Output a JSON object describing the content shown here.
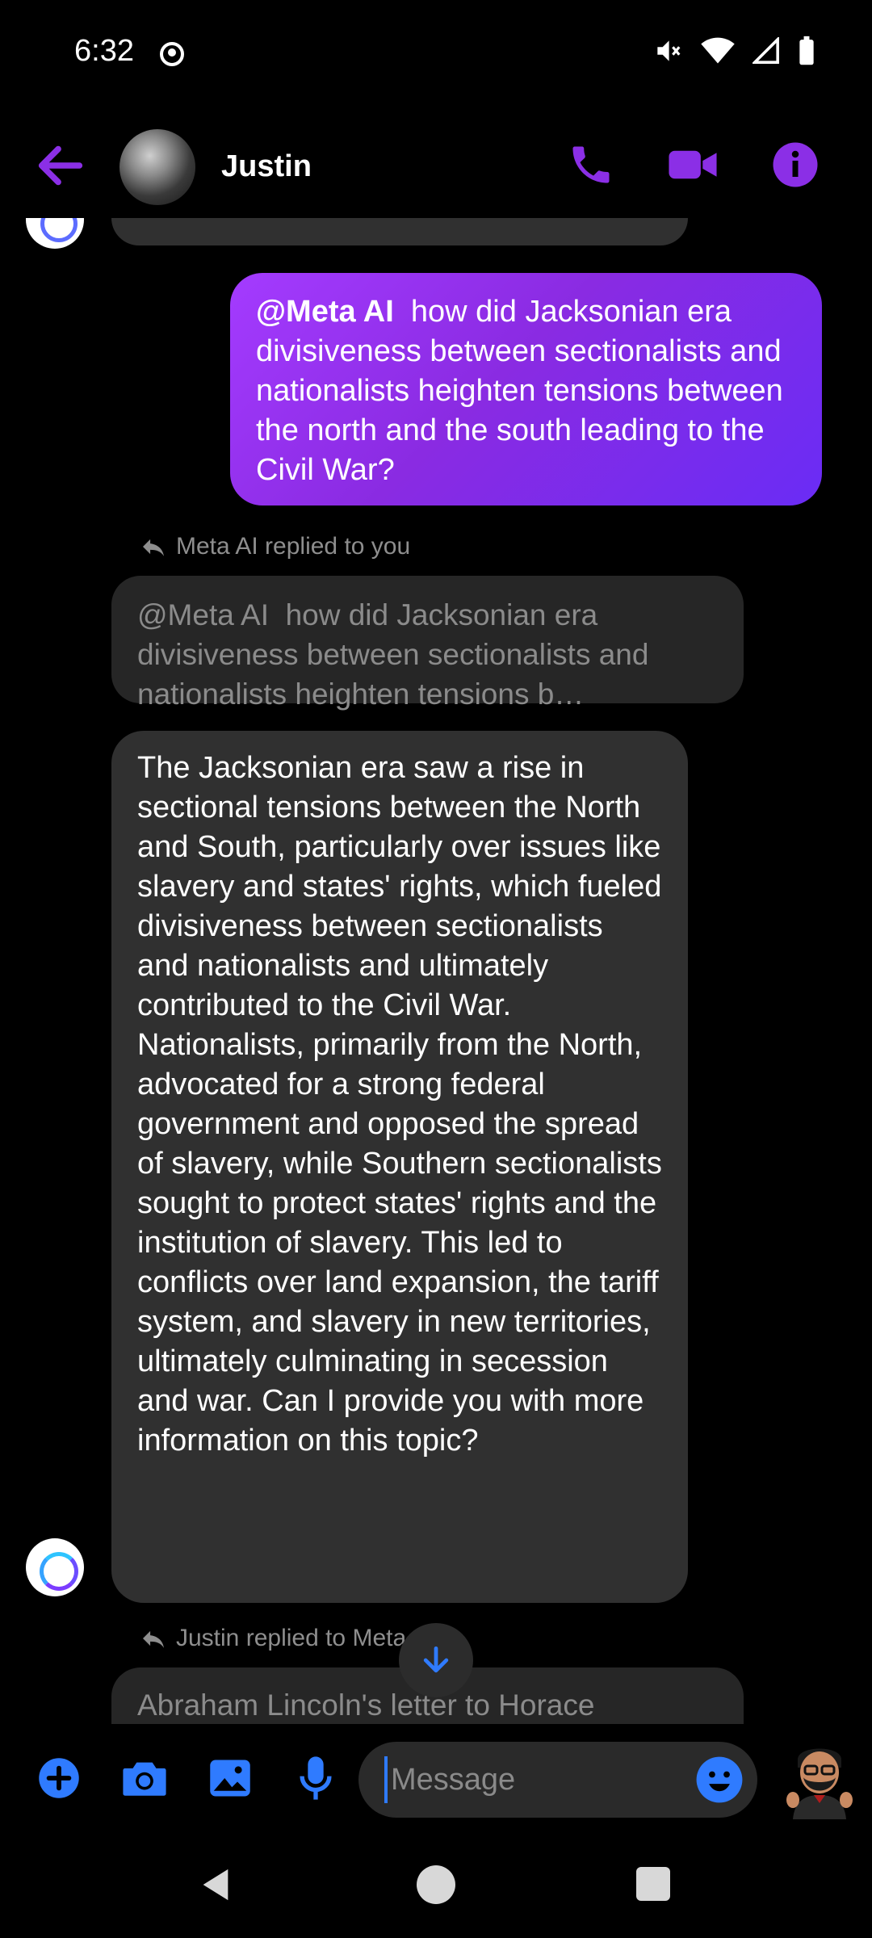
{
  "status_bar": {
    "time": "6:32",
    "icons": [
      "headset-icon",
      "mute-icon",
      "wifi-icon",
      "signal-icon",
      "battery-icon"
    ]
  },
  "header": {
    "contact_name": "Justin",
    "icons": [
      "back-arrow-icon",
      "phone-icon",
      "video-icon",
      "info-icon"
    ],
    "accent_color": "#8b2fe6"
  },
  "messages": {
    "outgoing": {
      "mention": "@Meta AI",
      "text": "how did Jacksonian era divisiveness between sectionalists and nationalists heighten tensions between the north and the south leading to the Civil War?"
    },
    "reply_label_1": "Meta AI replied to you",
    "quoted": {
      "mention": "@Meta AI",
      "text": "how did Jacksonian era divisiveness between sectionalists and nationalists heighten tensions b…"
    },
    "ai_response": "The Jacksonian era saw a rise in sectional tensions between the North and South, particularly over issues like slavery and states' rights, which fueled divisiveness between sectionalists and nationalists and ultimately contributed to the Civil War. Nationalists, primarily from the North, advocated for a strong federal government and opposed the spread of slavery, while Southern sectionalists sought to protect states' rights and the institution of slavery. This led to conflicts over land expansion, the tariff system, and slavery in new territories, ultimately culminating in secession and war. Can I provide you with more information on this topic?",
    "reply_label_2": "Justin replied to Meta AI",
    "quoted_2": "Abraham Lincoln's letter to Horace"
  },
  "composer": {
    "placeholder": "Message",
    "icons": [
      "plus-icon",
      "camera-icon",
      "gallery-icon",
      "mic-icon",
      "emoji-icon"
    ],
    "accent_color": "#2f7bff"
  },
  "colors": {
    "outgoing_bubble": "#8a2be2",
    "incoming_bubble": "#303030",
    "background": "#000000"
  }
}
